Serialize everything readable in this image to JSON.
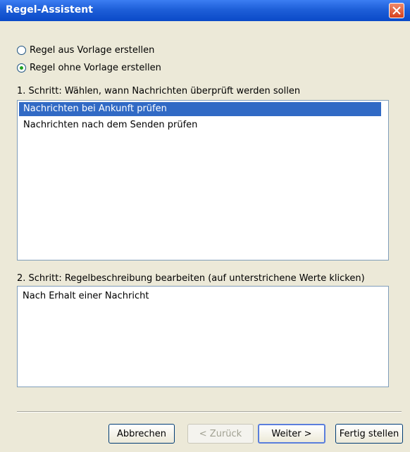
{
  "window": {
    "title": "Regel-Assistent"
  },
  "mode_options": [
    {
      "label": "Regel aus Vorlage erstellen",
      "checked": false
    },
    {
      "label": "Regel ohne Vorlage erstellen",
      "checked": true
    }
  ],
  "step1": {
    "label": "1. Schritt: Wählen, wann Nachrichten überprüft werden sollen",
    "items": [
      {
        "label": "Nachrichten bei Ankunft prüfen",
        "selected": true
      },
      {
        "label": "Nachrichten nach dem Senden prüfen",
        "selected": false
      }
    ]
  },
  "step2": {
    "label": "2. Schritt: Regelbeschreibung bearbeiten (auf unterstrichene Werte klicken)",
    "description": "Nach Erhalt einer Nachricht"
  },
  "buttons": {
    "cancel": "Abbrechen",
    "back": "< Zurück",
    "next": "Weiter >",
    "finish": "Fertig stellen"
  },
  "colors": {
    "titlebar": "#0a49c8",
    "selection": "#316ac5",
    "radio_dot": "#21a121",
    "close_button": "#d6401d"
  }
}
